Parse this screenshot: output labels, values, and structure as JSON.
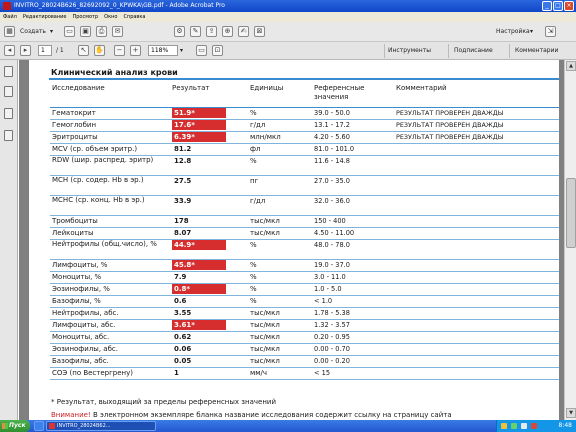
{
  "window": {
    "title": "INVITRO_28024B626_82692092_0_KРWKA\\GB.pdf - Adobe Acrobat Pro"
  },
  "menu": [
    "Файл",
    "Редактирование",
    "Просмотр",
    "Окно",
    "Справка"
  ],
  "toolbar": {
    "create_label": "Создать",
    "customize_label": "Настройка",
    "page_current": "1",
    "page_total": "/ 1",
    "zoom": "118%",
    "tools_label": "Инструменты",
    "sign_label": "Подписание",
    "comments_label": "Комментарии"
  },
  "report": {
    "section_title": "Клинический анализ крови",
    "columns": [
      "Исследование",
      "Результат",
      "Единицы",
      "Референсные значения",
      "Комментарий"
    ],
    "rows": [
      {
        "name": "Гематокрит",
        "result": "51.9*",
        "unit": "%",
        "ref": "39.0 - 50.0",
        "comment": "РЕЗУЛЬТАТ ПРОВЕРЕН ДВАЖДЫ",
        "flag": true
      },
      {
        "name": "Гемоглобин",
        "result": "17.6*",
        "unit": "г/дл",
        "ref": "13.1 - 17.2",
        "comment": "РЕЗУЛЬТАТ ПРОВЕРЕН ДВАЖДЫ",
        "flag": true
      },
      {
        "name": "Эритроциты",
        "result": "6.39*",
        "unit": "млн/мкл",
        "ref": "4.20 - 5.60",
        "comment": "РЕЗУЛЬТАТ ПРОВЕРЕН ДВАЖДЫ",
        "flag": true
      },
      {
        "name": "MCV (ср. объем эритр.)",
        "result": "81.2",
        "unit": "фл",
        "ref": "81.0 - 101.0",
        "comment": "",
        "flag": false
      },
      {
        "name": "RDW (шир. распред. эритр)",
        "result": "12.8",
        "unit": "%",
        "ref": "11.6 - 14.8",
        "comment": "",
        "flag": false
      },
      {
        "name": "MCH (ср. содер. Hb в эр.)",
        "result": "27.5",
        "unit": "пг",
        "ref": "27.0 - 35.0",
        "comment": "",
        "flag": false
      },
      {
        "name": "MCHC (ср. конц. Hb в эр.)",
        "result": "33.9",
        "unit": "г/дл",
        "ref": "32.0 - 36.0",
        "comment": "",
        "flag": false
      },
      {
        "name": "Тромбоциты",
        "result": "178",
        "unit": "тыс/мкл",
        "ref": "150 - 400",
        "comment": "",
        "flag": false
      },
      {
        "name": "Лейкоциты",
        "result": "8.07",
        "unit": "тыс/мкл",
        "ref": "4.50 - 11.00",
        "comment": "",
        "flag": false
      },
      {
        "name": "Нейтрофилы (общ.число), %",
        "result": "44.9*",
        "unit": "%",
        "ref": "48.0 - 78.0",
        "comment": "",
        "flag": true
      },
      {
        "name": "Лимфоциты, %",
        "result": "45.8*",
        "unit": "%",
        "ref": "19.0 - 37.0",
        "comment": "",
        "flag": true
      },
      {
        "name": "Моноциты, %",
        "result": "7.9",
        "unit": "%",
        "ref": "3.0 - 11.0",
        "comment": "",
        "flag": false
      },
      {
        "name": "Эозинофилы, %",
        "result": "0.8*",
        "unit": "%",
        "ref": "1.0 - 5.0",
        "comment": "",
        "flag": true
      },
      {
        "name": "Базофилы, %",
        "result": "0.6",
        "unit": "%",
        "ref": "< 1.0",
        "comment": "",
        "flag": false
      },
      {
        "name": "Нейтрофилы, абс.",
        "result": "3.55",
        "unit": "тыс/мкл",
        "ref": "1.78 - 5.38",
        "comment": "",
        "flag": false
      },
      {
        "name": "Лимфоциты, абс.",
        "result": "3.61*",
        "unit": "тыс/мкл",
        "ref": "1.32 - 3.57",
        "comment": "",
        "flag": true
      },
      {
        "name": "Моноциты, абс.",
        "result": "0.62",
        "unit": "тыс/мкл",
        "ref": "0.20 - 0.95",
        "comment": "",
        "flag": false
      },
      {
        "name": "Эозинофилы, абс.",
        "result": "0.06",
        "unit": "тыс/мкл",
        "ref": "0.00 - 0.70",
        "comment": "",
        "flag": false
      },
      {
        "name": "Базофилы, абс.",
        "result": "0.05",
        "unit": "тыс/мкл",
        "ref": "0.00 - 0.20",
        "comment": "",
        "flag": false
      },
      {
        "name": "СОЭ (по Вестергрену)",
        "result": "1",
        "unit": "мм/ч",
        "ref": "< 15",
        "comment": "",
        "flag": false
      }
    ],
    "footnote": "* Результат, выходящий за пределы референсных значений",
    "warning_label": "Внимание!",
    "warning_text": " В электронном экземпляре бланка название исследования содержит ссылку на страницу сайта"
  },
  "taskbar": {
    "start_label": "Пуск",
    "tasks": [
      "",
      "INVITRO_28024B62...",
      "",
      ""
    ],
    "clock": "8:48"
  },
  "colors": {
    "flag_bg": "#d62e2e",
    "table_line": "#3b8bd0",
    "warning": "#cc2222"
  }
}
